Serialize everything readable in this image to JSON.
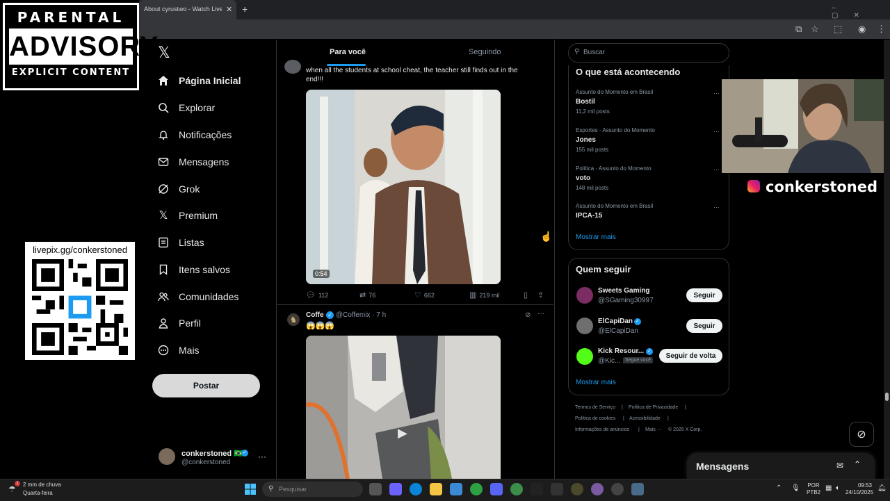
{
  "browser": {
    "tab_title": "About cyrustwo - Watch Live o",
    "tab_close": "✕",
    "new_tab": "+"
  },
  "overlays": {
    "parental_advisory": {
      "top": "PARENTAL",
      "middle": "ADVISORY",
      "bottom": "EXPLICIT CONTENT"
    },
    "qr_url": "livepix.gg/conkerstoned",
    "streamer_handle": "conkerstoned"
  },
  "sidebar": {
    "logo": "𝕏",
    "items": [
      {
        "label": "Página Inicial",
        "icon": "home-icon"
      },
      {
        "label": "Explorar",
        "icon": "search-icon"
      },
      {
        "label": "Notificações",
        "icon": "bell-icon"
      },
      {
        "label": "Mensagens",
        "icon": "envelope-icon"
      },
      {
        "label": "Grok",
        "icon": "grok-icon"
      },
      {
        "label": "Premium",
        "icon": "x-icon"
      },
      {
        "label": "Listas",
        "icon": "list-icon"
      },
      {
        "label": "Itens salvos",
        "icon": "bookmark-icon"
      },
      {
        "label": "Comunidades",
        "icon": "people-icon"
      },
      {
        "label": "Perfil",
        "icon": "person-icon"
      },
      {
        "label": "Mais",
        "icon": "more-circle-icon"
      }
    ],
    "post_button": "Postar",
    "account": {
      "name": "conkerstoned 🇧🇷",
      "handle": "@conkerstoned"
    }
  },
  "timeline": {
    "tabs": [
      "Para você",
      "Seguindo"
    ],
    "active_tab": "Para você",
    "tweet1": {
      "text": "when all the students at school cheat, the teacher still finds out in the end!!!",
      "video_duration": "0:54",
      "replies": "112",
      "reposts": "76",
      "likes": "662",
      "views": "219 mil"
    },
    "tweet2": {
      "name": "Coffe",
      "handle": "@Coffemix · 7 h",
      "text": "😱😱😱"
    }
  },
  "right": {
    "search_placeholder": "Buscar",
    "trends_title": "O que está acontecendo",
    "trends": [
      {
        "meta": "Assunto do Momento em Brasil",
        "name": "Bostil",
        "count": "11,2 mil posts"
      },
      {
        "meta": "Esportes · Assunto do Momento",
        "name": "Jones",
        "count": "155 mil posts"
      },
      {
        "meta": "Política · Assunto do Momento",
        "name": "voto",
        "count": "148 mil posts"
      },
      {
        "meta": "Assunto do Momento em Brasil",
        "name": "IPCA-15",
        "count": ""
      }
    ],
    "trends_more": "Mostrar mais",
    "follow_title": "Quem seguir",
    "follow": [
      {
        "name": "Sweets Gaming",
        "handle": "@SGaming30997",
        "button": "Seguir"
      },
      {
        "name": "ElCapiDan",
        "handle": "@ElCapiDan",
        "button": "Seguir"
      },
      {
        "name": "Kick Resour...",
        "handle": "@Kic...",
        "button": "Seguir de volta",
        "badge": "Segue você"
      }
    ],
    "follow_more": "Mostrar mais",
    "footer": [
      "Termos de Serviço",
      "Política de Privacidade",
      "Política de cookies",
      "Acessibilidade",
      "Informações de anúncios",
      "Mais ···",
      "© 2025 X Corp."
    ],
    "messages_title": "Mensagens"
  },
  "taskbar": {
    "weather_line1": "2 mm de chuva",
    "weather_line2": "Quarta-feira",
    "weather_badge": "1",
    "search_placeholder": "Pesquisar",
    "lang_line1": "POR",
    "lang_line2": "PTB2",
    "time": "09:53",
    "date": "24/10/2025"
  },
  "colors": {
    "accent": "#1d9bf0",
    "background": "#000000",
    "text": "#e7e9ea",
    "muted": "#8b98a5"
  }
}
